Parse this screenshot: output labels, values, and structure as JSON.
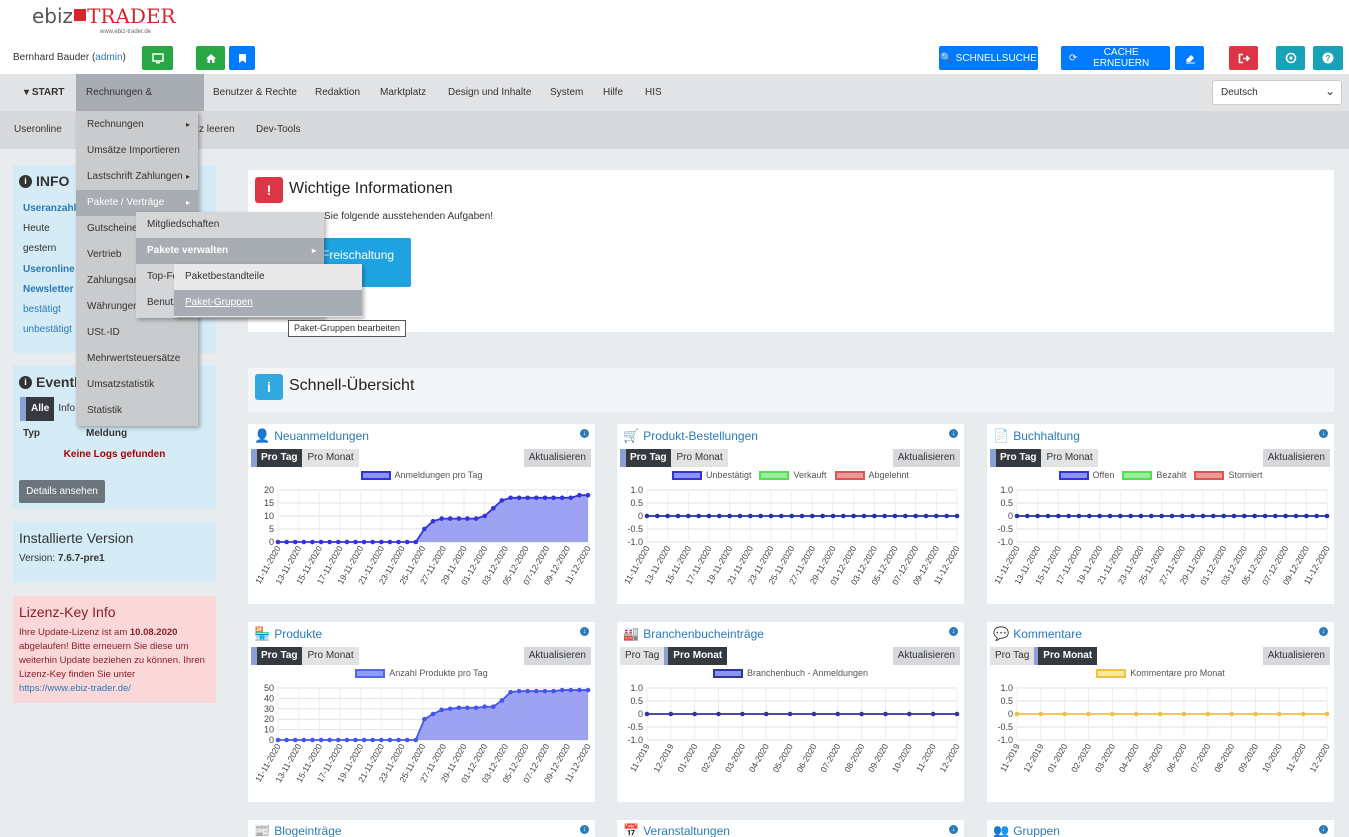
{
  "header": {
    "logo_left": "ebiz",
    "logo_right": "TRADER",
    "logo_sub": "www.ebiz-trader.de",
    "user_name": "Bernhard Bauder",
    "user_role": "admin",
    "quicksearch": "SCHNELLSUCHE",
    "cache": "CACHE ERNEUERN"
  },
  "nav": {
    "items": [
      "START",
      "Rechnungen & Finanzen",
      "Benutzer & Rechte",
      "Redaktion",
      "Marktplatz",
      "Design und Inhalte",
      "System",
      "Hilfe",
      "HIS"
    ],
    "language": "Deutsch"
  },
  "subnav": {
    "items": [
      "Useronline",
      "z leeren",
      "Dev-Tools"
    ]
  },
  "menu1": {
    "items": [
      "Rechnungen",
      "Umsätze Importieren",
      "Lastschrift Zahlungen",
      "Pakete / Verträge",
      "Gutscheine",
      "Vertrieb",
      "Zahlungsart",
      "Währungen",
      "USt.-ID",
      "Mehrwertsteuersätze",
      "Umsatzstatistik",
      "Statistik"
    ]
  },
  "menu2": {
    "items": [
      "Mitgliedschaften",
      "Pakete verwalten",
      "Top-Fe",
      "Benutz"
    ]
  },
  "menu3": {
    "items": [
      "Paketbestandteile",
      "Paket-Gruppen"
    ],
    "tooltip": "Paket-Gruppen bearbeiten"
  },
  "info": {
    "title": "INFO",
    "rows": [
      "Useranzahl",
      "Heute",
      "gestern",
      "Useronline",
      "Newsletter",
      "bestätigt",
      "unbestätigt"
    ]
  },
  "events": {
    "title": "Eventl",
    "tab_all": "Alle",
    "tab_info": "Info",
    "col_type": "Typ",
    "col_msg": "Meldung",
    "empty": "Keine Logs gefunden",
    "details": "Details ansehen"
  },
  "version": {
    "title": "Installierte Version",
    "label": "Version:",
    "value": "7.6.7-pre1"
  },
  "license": {
    "title": "Lizenz-Key Info",
    "text1": "Ihre Update-Lizenz ist am ",
    "date": "10.08.2020",
    "text2": " abgelaufen! Bitte erneuern Sie diese um weiterhin Update beziehen zu können. Ihren Lizenz-Key finden Sie unter",
    "link": "https://www.ebiz-trader.de/"
  },
  "important": {
    "title": "Wichtige Informationen",
    "text": "Sie folgende ausstehenden Aufgaben!",
    "button": "Freischaltung"
  },
  "overview": {
    "title": "Schnell-Übersicht"
  },
  "cards": [
    {
      "title": "Neuanmeldungen",
      "tab1": "Pro Tag",
      "tab2": "Pro Monat",
      "update": "Aktualisieren",
      "legend": [
        "Anmeldungen pro Tag"
      ]
    },
    {
      "title": "Produkt-Bestellungen",
      "tab1": "Pro Tag",
      "tab2": "Pro Monat",
      "update": "Aktualisieren",
      "legend": [
        "Unbestätigt",
        "Verkauft",
        "Abgelehnt"
      ]
    },
    {
      "title": "Buchhaltung",
      "tab1": "Pro Tag",
      "tab2": "Pro Monat",
      "update": "Aktualisieren",
      "legend": [
        "Offen",
        "Bezahlt",
        "Storniert"
      ]
    },
    {
      "title": "Produkte",
      "tab1": "Pro Tag",
      "tab2": "Pro Monat",
      "update": "Aktualisieren",
      "legend": [
        "Anzahl Produkte pro Tag"
      ]
    },
    {
      "title": "Branchenbucheinträge",
      "tab1": "Pro Tag",
      "tab2": "Pro Monat",
      "update": "Aktualisieren",
      "legend": [
        "Branchenbuch - Anmeldungen"
      ]
    },
    {
      "title": "Kommentare",
      "tab1": "Pro Tag",
      "tab2": "Pro Monat",
      "update": "Aktualisieren",
      "legend": [
        "Kommentare pro Monat"
      ]
    }
  ],
  "bottom_cards": [
    "Blogeinträge",
    "Veranstaltungen",
    "Gruppen"
  ],
  "colors": {
    "blue": "#007bff",
    "green": "#28a745",
    "red": "#dc3545",
    "cyan": "#17a2b8",
    "series_blue": "#3333dd",
    "series_fill": "#8c93f0",
    "yellow": "#f0c040"
  },
  "chart_data": [
    {
      "type": "area",
      "title": "Neuanmeldungen",
      "series": [
        {
          "name": "Anmeldungen pro Tag",
          "values": [
            0,
            0,
            0,
            0,
            0,
            0,
            0,
            0,
            0,
            0,
            0,
            0,
            0,
            0,
            0,
            0,
            0,
            5,
            8,
            9,
            9,
            9,
            9,
            9,
            10,
            13,
            16,
            17,
            17,
            17,
            17,
            17,
            17,
            17,
            17,
            18,
            18
          ]
        }
      ],
      "x": [
        "11-11-2020",
        "13-11-2020",
        "15-11-2020",
        "17-11-2020",
        "19-11-2020",
        "21-11-2020",
        "23-11-2020",
        "25-11-2020",
        "27-11-2020",
        "29-11-2020",
        "01-12-2020",
        "03-12-2020",
        "05-12-2020",
        "07-12-2020",
        "09-12-2020",
        "11-12-2020"
      ],
      "yticks": [
        0,
        5,
        10,
        15,
        20
      ],
      "ylim": [
        0,
        20
      ]
    },
    {
      "type": "line",
      "title": "Produkt-Bestellungen",
      "series": [
        {
          "name": "Unbestätigt",
          "values": [
            0
          ]
        },
        {
          "name": "Verkauft",
          "values": [
            0
          ]
        },
        {
          "name": "Abgelehnt",
          "values": [
            0
          ]
        }
      ],
      "x": [
        "11-11-2020",
        "13-11-2020",
        "15-11-2020",
        "17-11-2020",
        "19-11-2020",
        "21-11-2020",
        "23-11-2020",
        "25-11-2020",
        "27-11-2020",
        "29-11-2020",
        "01-12-2020",
        "03-12-2020",
        "05-12-2020",
        "07-12-2020",
        "09-12-2020",
        "11-12-2020"
      ],
      "yticks": [
        -1.0,
        -0.5,
        0,
        0.5,
        1.0
      ],
      "ylim": [
        -1,
        1
      ]
    },
    {
      "type": "line",
      "title": "Buchhaltung",
      "series": [
        {
          "name": "Offen",
          "values": [
            0
          ]
        },
        {
          "name": "Bezahlt",
          "values": [
            0
          ]
        },
        {
          "name": "Storniert",
          "values": [
            0
          ]
        }
      ],
      "x": [
        "11-11-2020",
        "13-11-2020",
        "15-11-2020",
        "17-11-2020",
        "19-11-2020",
        "21-11-2020",
        "23-11-2020",
        "25-11-2020",
        "27-11-2020",
        "29-11-2020",
        "01-12-2020",
        "03-12-2020",
        "05-12-2020",
        "07-12-2020",
        "09-12-2020",
        "11-12-2020"
      ],
      "yticks": [
        -1.0,
        -0.5,
        0,
        0.5,
        1.0
      ],
      "ylim": [
        -1,
        1
      ]
    },
    {
      "type": "area",
      "title": "Produkte",
      "series": [
        {
          "name": "Anzahl Produkte pro Tag",
          "values": [
            0,
            0,
            0,
            0,
            0,
            0,
            0,
            0,
            0,
            0,
            0,
            0,
            0,
            0,
            0,
            0,
            0,
            20,
            25,
            29,
            30,
            31,
            31,
            31,
            32,
            32,
            38,
            46,
            47,
            47,
            47,
            47,
            47,
            48,
            48,
            48,
            48
          ]
        }
      ],
      "x": [
        "11-11-2020",
        "13-11-2020",
        "15-11-2020",
        "17-11-2020",
        "19-11-2020",
        "21-11-2020",
        "23-11-2020",
        "25-11-2020",
        "27-11-2020",
        "29-11-2020",
        "01-12-2020",
        "03-12-2020",
        "05-12-2020",
        "07-12-2020",
        "09-12-2020",
        "11-12-2020"
      ],
      "yticks": [
        0,
        10,
        20,
        30,
        40,
        50
      ],
      "ylim": [
        0,
        50
      ]
    },
    {
      "type": "line",
      "title": "Branchenbucheinträge",
      "series": [
        {
          "name": "Branchenbuch - Anmeldungen",
          "values": [
            0,
            0,
            0,
            0,
            0,
            0,
            0,
            0,
            0,
            0,
            0,
            0,
            0,
            0
          ]
        }
      ],
      "x": [
        "11-2019",
        "12-2019",
        "01-2020",
        "02-2020",
        "03-2020",
        "04-2020",
        "05-2020",
        "06-2020",
        "07-2020",
        "08-2020",
        "09-2020",
        "10-2020",
        "11-2020",
        "12-2020"
      ],
      "yticks": [
        -1.0,
        -0.5,
        0,
        0.5,
        1.0
      ],
      "ylim": [
        -1,
        1
      ]
    },
    {
      "type": "line",
      "title": "Kommentare",
      "series": [
        {
          "name": "Kommentare pro Monat",
          "values": [
            0,
            0,
            0,
            0,
            0,
            0,
            0,
            0,
            0,
            0,
            0,
            0,
            0,
            0
          ]
        }
      ],
      "x": [
        "11-2019",
        "12-2019",
        "01-2020",
        "02-2020",
        "03-2020",
        "04-2020",
        "05-2020",
        "06-2020",
        "07-2020",
        "08-2020",
        "09-2020",
        "10-2020",
        "11-2020",
        "12-2020"
      ],
      "yticks": [
        -1.0,
        -0.5,
        0,
        0.5,
        1.0
      ],
      "ylim": [
        -1,
        1
      ]
    }
  ]
}
